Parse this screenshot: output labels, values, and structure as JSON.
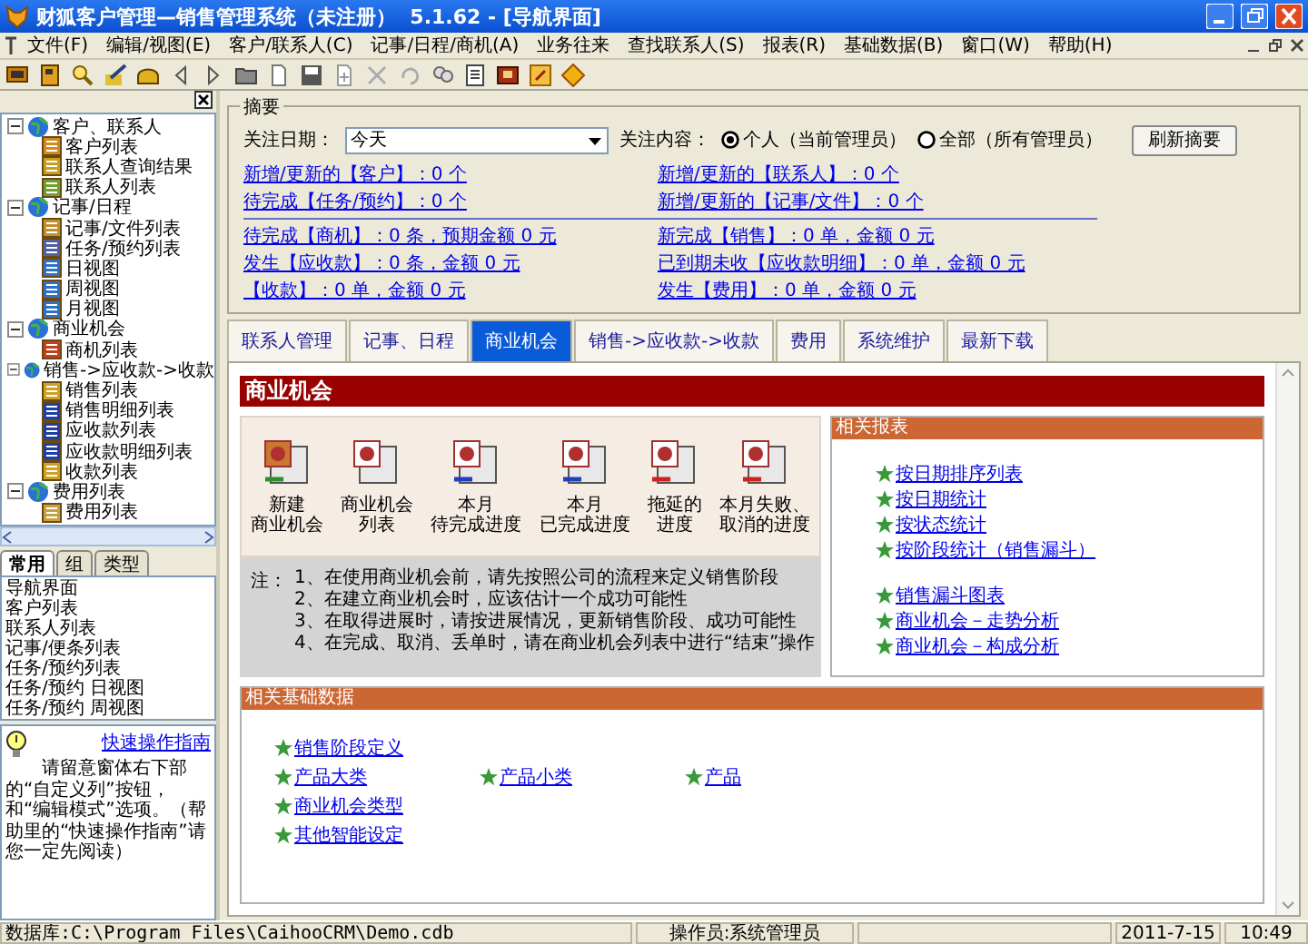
{
  "window": {
    "title": "财狐客户管理—销售管理系统（未注册）  5.1.62 - [导航界面]"
  },
  "menu": [
    "文件(F)",
    "编辑/视图(E)",
    "客户/联系人(C)",
    "记事/日程/商机(A)",
    "业务往来",
    "查找联系人(S)",
    "报表(R)",
    "基础数据(B)",
    "窗口(W)",
    "帮助(H)"
  ],
  "sidebar": {
    "tree": [
      {
        "label": "客户、联系人",
        "expanded": true,
        "children": [
          {
            "label": "客户列表"
          },
          {
            "label": "联系人查询结果"
          },
          {
            "label": "联系人列表"
          }
        ]
      },
      {
        "label": "记事/日程",
        "expanded": true,
        "children": [
          {
            "label": "记事/文件列表"
          },
          {
            "label": "任务/预约列表"
          },
          {
            "label": "日视图"
          },
          {
            "label": "周视图"
          },
          {
            "label": "月视图"
          }
        ]
      },
      {
        "label": "商业机会",
        "expanded": true,
        "children": [
          {
            "label": "商机列表"
          }
        ]
      },
      {
        "label": "销售->应收款->收款",
        "expanded": true,
        "children": [
          {
            "label": "销售列表"
          },
          {
            "label": "销售明细列表"
          },
          {
            "label": "应收款列表"
          },
          {
            "label": "应收款明细列表"
          },
          {
            "label": "收款列表"
          }
        ]
      },
      {
        "label": "费用列表",
        "expanded": true,
        "children": [
          {
            "label": "费用列表"
          }
        ]
      }
    ],
    "tabs": [
      {
        "label": "常用",
        "selected": true
      },
      {
        "label": "组",
        "selected": false
      },
      {
        "label": "类型",
        "selected": false
      }
    ],
    "list": [
      "导航界面",
      "客户列表",
      "联系人列表",
      "记事/便条列表",
      "任务/预约列表",
      "任务/预约 日视图",
      "任务/预约 周视图"
    ],
    "hint": {
      "link": "快速操作指南",
      "text": "请留意窗体右下部的“自定义列”按钮，和“编辑模式”选项。（帮助里的“快速操作指南”请您一定先阅读）"
    }
  },
  "summary": {
    "legend": "摘要",
    "date_label": "关注日期：",
    "date_value": "今天",
    "content_label": "关注内容：",
    "scope": [
      {
        "label": "个人（当前管理员）",
        "selected": true
      },
      {
        "label": "全部（所有管理员）",
        "selected": false
      }
    ],
    "refresh_button": "刷新摘要",
    "link_groups": [
      [
        "新增/更新的【客户】：0 个",
        "新增/更新的【联系人】：0 个",
        "待完成【任务/预约】：0 个",
        "新增/更新的【记事/文件】：0 个"
      ],
      [
        "待完成【商机】：0 条，预期金额 0 元",
        "新完成【销售】：0 单，金额 0 元",
        "发生【应收款】：0 条，金额 0 元",
        "已到期未收【应收款明细】：0 单，金额 0 元",
        "【收款】：0 单，金额 0 元",
        "发生【费用】：0 单，金额 0 元"
      ]
    ]
  },
  "tabs": [
    {
      "label": "联系人管理",
      "selected": false
    },
    {
      "label": "记事、日程",
      "selected": false
    },
    {
      "label": "商业机会",
      "selected": true
    },
    {
      "label": "销售->应收款->收款",
      "selected": false
    },
    {
      "label": "费用",
      "selected": false
    },
    {
      "label": "系统维护",
      "selected": false
    },
    {
      "label": "最新下载",
      "selected": false
    }
  ],
  "page": {
    "title": "商业机会",
    "actions": [
      {
        "lines": [
          "新建",
          "商业机会"
        ]
      },
      {
        "lines": [
          "商业机会",
          "列表"
        ]
      },
      {
        "lines": [
          "本月",
          "待完成进度"
        ]
      },
      {
        "lines": [
          "本月",
          "已完成进度"
        ]
      },
      {
        "lines": [
          "拖延的",
          "进度"
        ]
      },
      {
        "lines": [
          "本月失败、",
          "取消的进度"
        ]
      }
    ],
    "notes": {
      "label": "注：",
      "lines": [
        "1、在使用商业机会前，请先按照公司的流程来定义销售阶段",
        "2、在建立商业机会时，应该估计一个成功可能性",
        "3、在取得进展时，请按进展情况，更新销售阶段、成功可能性",
        "4、在完成、取消、丢单时，请在商业机会列表中进行“结束”操作"
      ]
    },
    "reports": {
      "title": "相关报表",
      "groups": [
        [
          "按日期排序列表",
          "按日期统计",
          "按状态统计",
          "按阶段统计（销售漏斗）"
        ],
        [
          "销售漏斗图表",
          "商业机会－走势分析",
          "商业机会－构成分析"
        ]
      ]
    },
    "base_data": {
      "title": "相关基础数据",
      "rows": [
        [
          "销售阶段定义"
        ],
        [
          "产品大类",
          "产品小类",
          "产品"
        ],
        [
          "商业机会类型"
        ],
        [
          "其他智能设定"
        ]
      ]
    }
  },
  "status_bar": {
    "database": "数据库:C:\\Program Files\\CaihooCRM\\Demo.cdb",
    "operator": "操作员:系统管理员",
    "date": "2011-7-15",
    "time": "10:49"
  }
}
